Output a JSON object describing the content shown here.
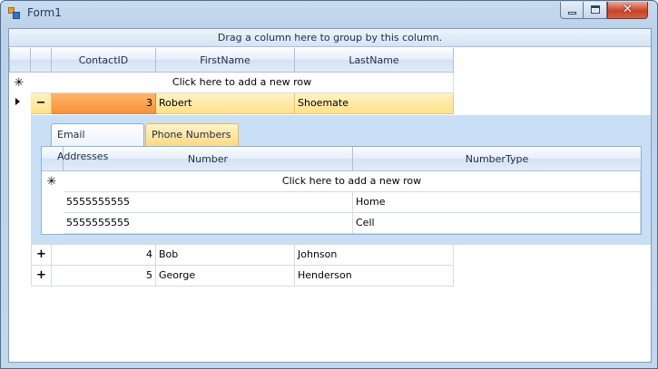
{
  "window": {
    "title": "Form1"
  },
  "grid": {
    "group_panel_text": "Drag a column here to group by this column.",
    "columns": [
      "ContactID",
      "FirstName",
      "LastName"
    ],
    "add_row_text": "Click here to add a new row",
    "rows": [
      {
        "contact_id": "3",
        "first_name": "Robert",
        "last_name": "Shoemate",
        "expander": "−",
        "selected": true
      },
      {
        "contact_id": "4",
        "first_name": "Bob",
        "last_name": "Johnson",
        "expander": "+"
      },
      {
        "contact_id": "5",
        "first_name": "George",
        "last_name": "Henderson",
        "expander": "+"
      }
    ]
  },
  "child": {
    "tabs": [
      {
        "label": "Email Addresses",
        "active": true
      },
      {
        "label": "Phone Numbers",
        "active": false
      }
    ],
    "columns": [
      "Number",
      "NumberType"
    ],
    "add_row_text": "Click here to add a new row",
    "rows": [
      {
        "number": "5555555555",
        "type": "Home"
      },
      {
        "number": "5555555555",
        "type": "Cell"
      }
    ]
  },
  "icons": {
    "add_row_marker": "✳",
    "close_glyph": "✕"
  }
}
